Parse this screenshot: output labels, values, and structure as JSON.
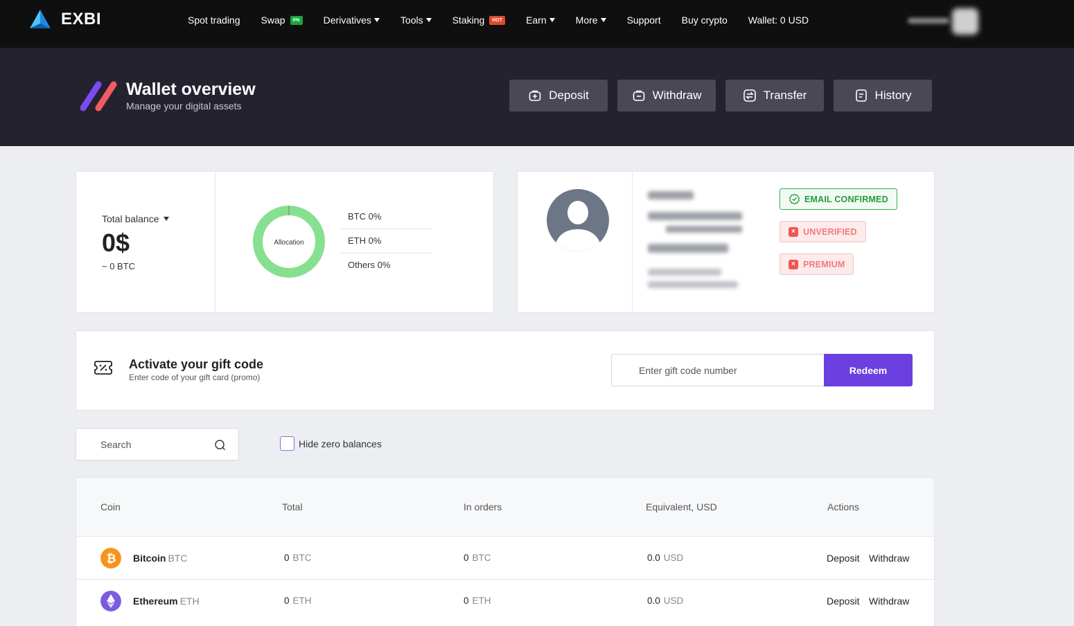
{
  "nav": {
    "brand": "EXBI",
    "items": [
      {
        "label": "Spot trading",
        "dropdown": false
      },
      {
        "label": "Swap",
        "badge": "0%",
        "badge_color": "#19a53b",
        "dropdown": false
      },
      {
        "label": "Derivatives",
        "dropdown": true
      },
      {
        "label": "Tools",
        "dropdown": true
      },
      {
        "label": "Staking",
        "badge": "HOT",
        "badge_color": "#e0492a",
        "dropdown": false
      },
      {
        "label": "Earn",
        "dropdown": true
      },
      {
        "label": "More",
        "dropdown": true
      },
      {
        "label": "Support",
        "dropdown": false
      },
      {
        "label": "Buy crypto",
        "dropdown": false
      },
      {
        "label": "Wallet: 0 USD",
        "dropdown": false
      }
    ]
  },
  "hero": {
    "title": "Wallet overview",
    "subtitle": "Manage your digital assets",
    "buttons": [
      "Deposit",
      "Withdraw",
      "Transfer",
      "History"
    ]
  },
  "balance": {
    "label": "Total balance",
    "value": "0$",
    "btc": "~ 0 BTC",
    "donut_label": "Allocation",
    "allocation": [
      "BTC 0%",
      "ETH 0%",
      "Others 0%"
    ],
    "donut_color": "#86e08f"
  },
  "profile": {
    "badges": [
      {
        "label": "EMAIL CONFIRMED",
        "status": "ok"
      },
      {
        "label": "UNVERIFIED",
        "status": "bad"
      },
      {
        "label": "PREMIUM",
        "status": "bad"
      }
    ]
  },
  "gift": {
    "title": "Activate your gift code",
    "subtitle": "Enter code of your gift card (promo)",
    "placeholder": "Enter gift code number",
    "button": "Redeem",
    "accent": "#6b3fe0"
  },
  "filters": {
    "search_placeholder": "Search",
    "hide_zero": "Hide zero balances"
  },
  "table": {
    "headers": [
      "Coin",
      "Total",
      "In orders",
      "Equivalent, USD",
      "Actions"
    ],
    "rows": [
      {
        "name": "Bitcoin",
        "symbol": "BTC",
        "total": "0",
        "total_unit": "BTC",
        "orders": "0",
        "orders_unit": "BTC",
        "usd": "0.0",
        "usd_unit": "USD",
        "actions": [
          "Deposit",
          "Withdraw"
        ],
        "icon": "bitcoin-icon",
        "color": "#f7931a"
      },
      {
        "name": "Ethereum",
        "symbol": "ETH",
        "total": "0",
        "total_unit": "ETH",
        "orders": "0",
        "orders_unit": "ETH",
        "usd": "0.0",
        "usd_unit": "USD",
        "actions": [
          "Deposit",
          "Withdraw"
        ],
        "icon": "ethereum-icon",
        "color": "#7b5ce0"
      }
    ]
  }
}
